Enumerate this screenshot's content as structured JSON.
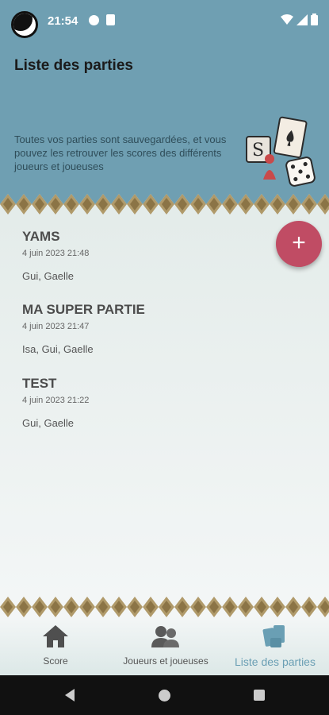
{
  "status": {
    "time": "21:54"
  },
  "header": {
    "title": "Liste des parties",
    "description": "Toutes vos parties sont sauvegardées, et vous pouvez les retrouver les scores des différents joueurs et joueuses"
  },
  "games": [
    {
      "title": "YAMS",
      "date": "4 juin 2023 21:48",
      "players": "Gui, Gaelle"
    },
    {
      "title": "MA SUPER PARTIE",
      "date": "4 juin 2023 21:47",
      "players": "Isa, Gui, Gaelle"
    },
    {
      "title": "TEST",
      "date": "4 juin 2023 21:22",
      "players": "Gui, Gaelle"
    }
  ],
  "fab": {
    "label": "+"
  },
  "nav": {
    "items": [
      {
        "label": "Score",
        "icon": "home-icon"
      },
      {
        "label": "Joueurs et joueuses",
        "icon": "users-icon"
      },
      {
        "label": "Liste des parties",
        "icon": "cards-icon",
        "active": true
      }
    ]
  },
  "colors": {
    "accent": "#6f9fb2",
    "fab": "#c04c64",
    "pattern_gold": "#b09a6a"
  }
}
